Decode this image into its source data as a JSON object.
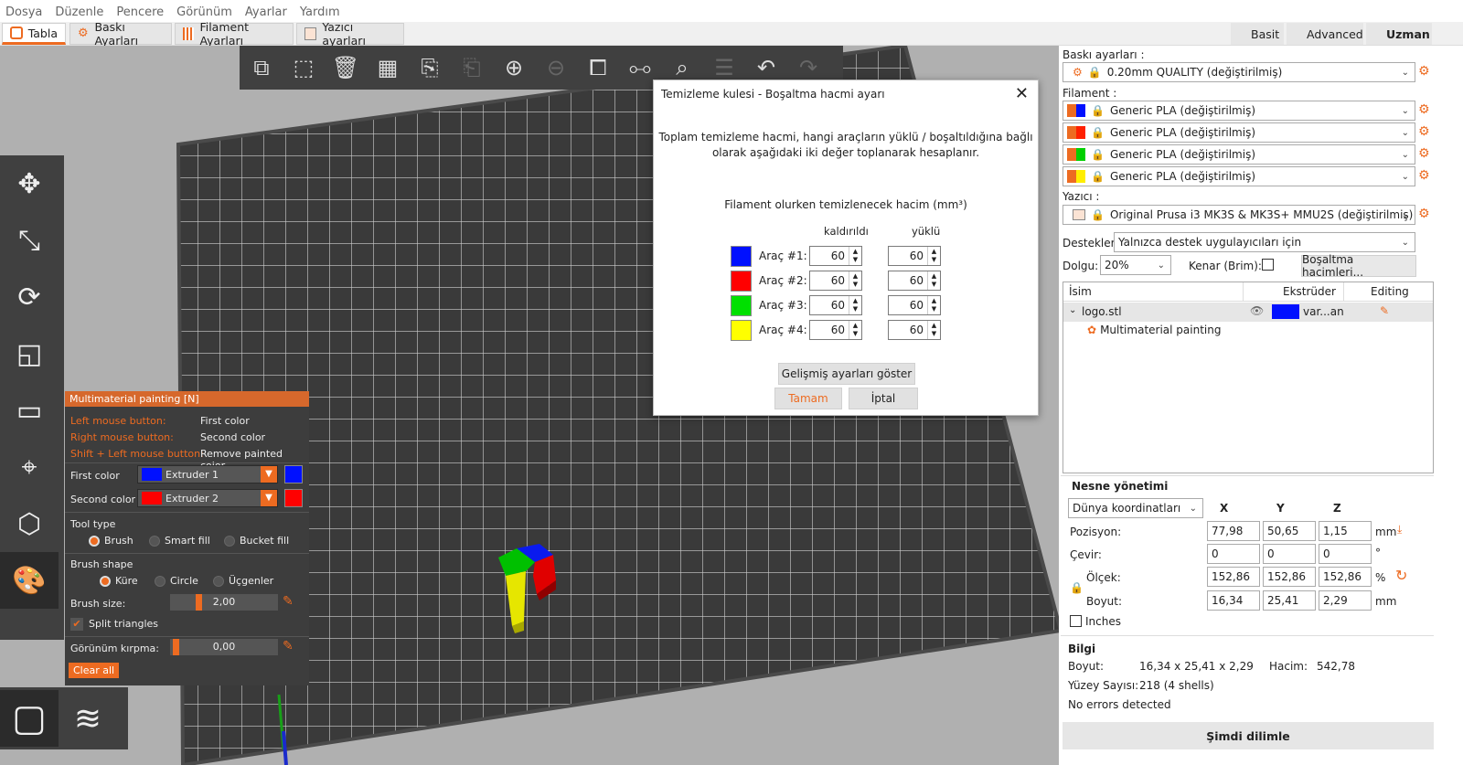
{
  "menu": [
    "Dosya",
    "Düzenle",
    "Pencere",
    "Görünüm",
    "Ayarlar",
    "Yardım"
  ],
  "tabs": [
    {
      "label": "Tabla"
    },
    {
      "label": "Baskı Ayarları"
    },
    {
      "label": "Filament Ayarları"
    },
    {
      "label": "Yazıcı ayarları"
    }
  ],
  "modes": [
    {
      "label": "Basit",
      "color": "#4caf50"
    },
    {
      "label": "Advanced",
      "color": "#f2c500"
    },
    {
      "label": "Uzman",
      "color": "#e0102c"
    }
  ],
  "paint_panel": {
    "title": "Multimaterial painting [N]",
    "left_mouse_label": "Left mouse button:",
    "left_mouse_value": "First color",
    "right_mouse_label": "Right mouse button:",
    "right_mouse_value": "Second color",
    "shift_label": "Shift + Left mouse button:",
    "shift_value": "Remove painted color",
    "first_color_label": "First color",
    "first_color_value": "Extruder 1",
    "second_color_label": "Second color",
    "second_color_value": "Extruder 2",
    "tool_type_label": "Tool type",
    "tool_brush": "Brush",
    "tool_smart": "Smart fill",
    "tool_bucket": "Bucket fill",
    "brush_shape_label": "Brush shape",
    "shape_sphere": "Küre",
    "shape_circle": "Circle",
    "shape_tri": "Üçgenler",
    "brush_size_label": "Brush size:",
    "brush_size_value": "2,00",
    "split_label": "Split triangles",
    "clip_label": "Görünüm kırpma:",
    "clip_value": "0,00",
    "clear_all": "Clear all"
  },
  "dialog": {
    "title": "Temizleme kulesi - Boşaltma hacmi ayarı",
    "desc1": "Toplam temizleme hacmi, hangi araçların yüklü / boşaltıldığına bağlı",
    "desc2": "olarak aşağıdaki iki değer toplanarak hesaplanır.",
    "subtitle": "Filament olurken temizlenecek hacim (mm³)",
    "col_removed": "kaldırıldı",
    "col_loaded": "yüklü",
    "rows": [
      {
        "label": "Araç #1:",
        "color": "#0010ff",
        "removed": "60",
        "loaded": "60"
      },
      {
        "label": "Araç #2:",
        "color": "#ff0000",
        "removed": "60",
        "loaded": "60"
      },
      {
        "label": "Araç #3:",
        "color": "#00e000",
        "removed": "60",
        "loaded": "60"
      },
      {
        "label": "Araç #4:",
        "color": "#ffff00",
        "removed": "60",
        "loaded": "60"
      }
    ],
    "advanced_btn": "Gelişmiş ayarları göster",
    "ok_btn": "Tamam",
    "cancel_btn": "İptal"
  },
  "sidebar": {
    "print_label": "Baskı ayarları :",
    "print_value": "0.20mm QUALITY (değiştirilmiş)",
    "filament_label": "Filament :",
    "filaments": [
      {
        "value": "Generic PLA (değiştirilmiş)",
        "color": "#0010ff"
      },
      {
        "value": "Generic PLA (değiştirilmiş)",
        "color": "#ff2000"
      },
      {
        "value": "Generic PLA (değiştirilmiş)",
        "color": "#00d000"
      },
      {
        "value": "Generic PLA (değiştirilmiş)",
        "color": "#ffee00"
      }
    ],
    "printer_label": "Yazıcı :",
    "printer_value": "Original Prusa i3 MK3S & MK3S+ MMU2S (değiştirilmiş)",
    "supports_label": "Destekler:",
    "supports_value": "Yalnızca destek uygulayıcıları için",
    "infill_label": "Dolgu:",
    "infill_value": "20%",
    "brim_label": "Kenar (Brim):",
    "purge_btn": "Boşaltma hacimleri...",
    "list_col_name": "İsim",
    "list_col_extruder": "Ekstrüder",
    "list_col_editing": "Editing",
    "object_name": "logo.stl",
    "object_extruder": "var...an",
    "object_child": "Multimaterial painting",
    "manip_title": "Nesne yönetimi",
    "coord_value": "Dünya koordinatları",
    "axis_x": "X",
    "axis_y": "Y",
    "axis_z": "Z",
    "position_label": "Pozisyon:",
    "position": [
      "77,98",
      "50,65",
      "1,15"
    ],
    "position_unit": "mm",
    "rotate_label": "Çevir:",
    "rotate": [
      "0",
      "0",
      "0"
    ],
    "rotate_unit": "°",
    "scale_label": "Ölçek:",
    "scale": [
      "152,86",
      "152,86",
      "152,86"
    ],
    "scale_unit": "%",
    "size_label": "Boyut:",
    "size": [
      "16,34",
      "25,41",
      "2,29"
    ],
    "size_unit": "mm",
    "inches_label": "Inches",
    "info_title": "Bilgi",
    "info_size_label": "Boyut:",
    "info_size_value": "16,34 x 25,41 x 2,29",
    "info_volume_label": "Hacim:",
    "info_volume_value": "542,78",
    "info_facets_label": "Yüzey Sayısı:",
    "info_facets_value": "218 (4 shells)",
    "info_errors": "No errors detected",
    "slice_btn": "Şimdi dilimle"
  }
}
